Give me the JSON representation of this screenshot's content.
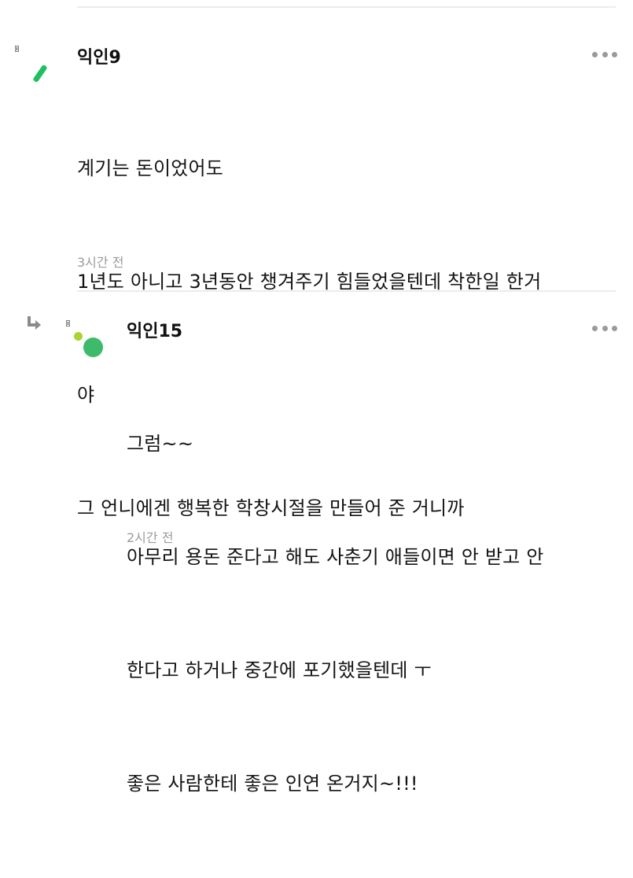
{
  "comments": [
    {
      "author": "익인9",
      "lines": [
        "계기는 돈이었어도",
        "1년도 아니고 3년동안 챙겨주기 힘들었을텐데 착한일 한거",
        "야",
        "그 언니에겐 행복한 학창시절을 만들어 준 거니까"
      ],
      "timestamp": "3시간 전",
      "avatar_color": "#1fbf62"
    },
    {
      "author": "익인15",
      "is_reply": true,
      "lines": [
        "그럼~~",
        "아무리 용돈 준다고 해도 사춘기 애들이면 안 받고 안",
        "한다고 하거나 중간에 포기했을텐데 ㅜ",
        "좋은 사람한테 좋은 인연 온거지~!!!"
      ],
      "timestamp": "2시간 전",
      "avatar_colors": [
        "#a6d534",
        "#3dbb6a"
      ]
    }
  ],
  "icons": {
    "more": "more-dots-icon",
    "reply": "reply-arrow-icon"
  }
}
